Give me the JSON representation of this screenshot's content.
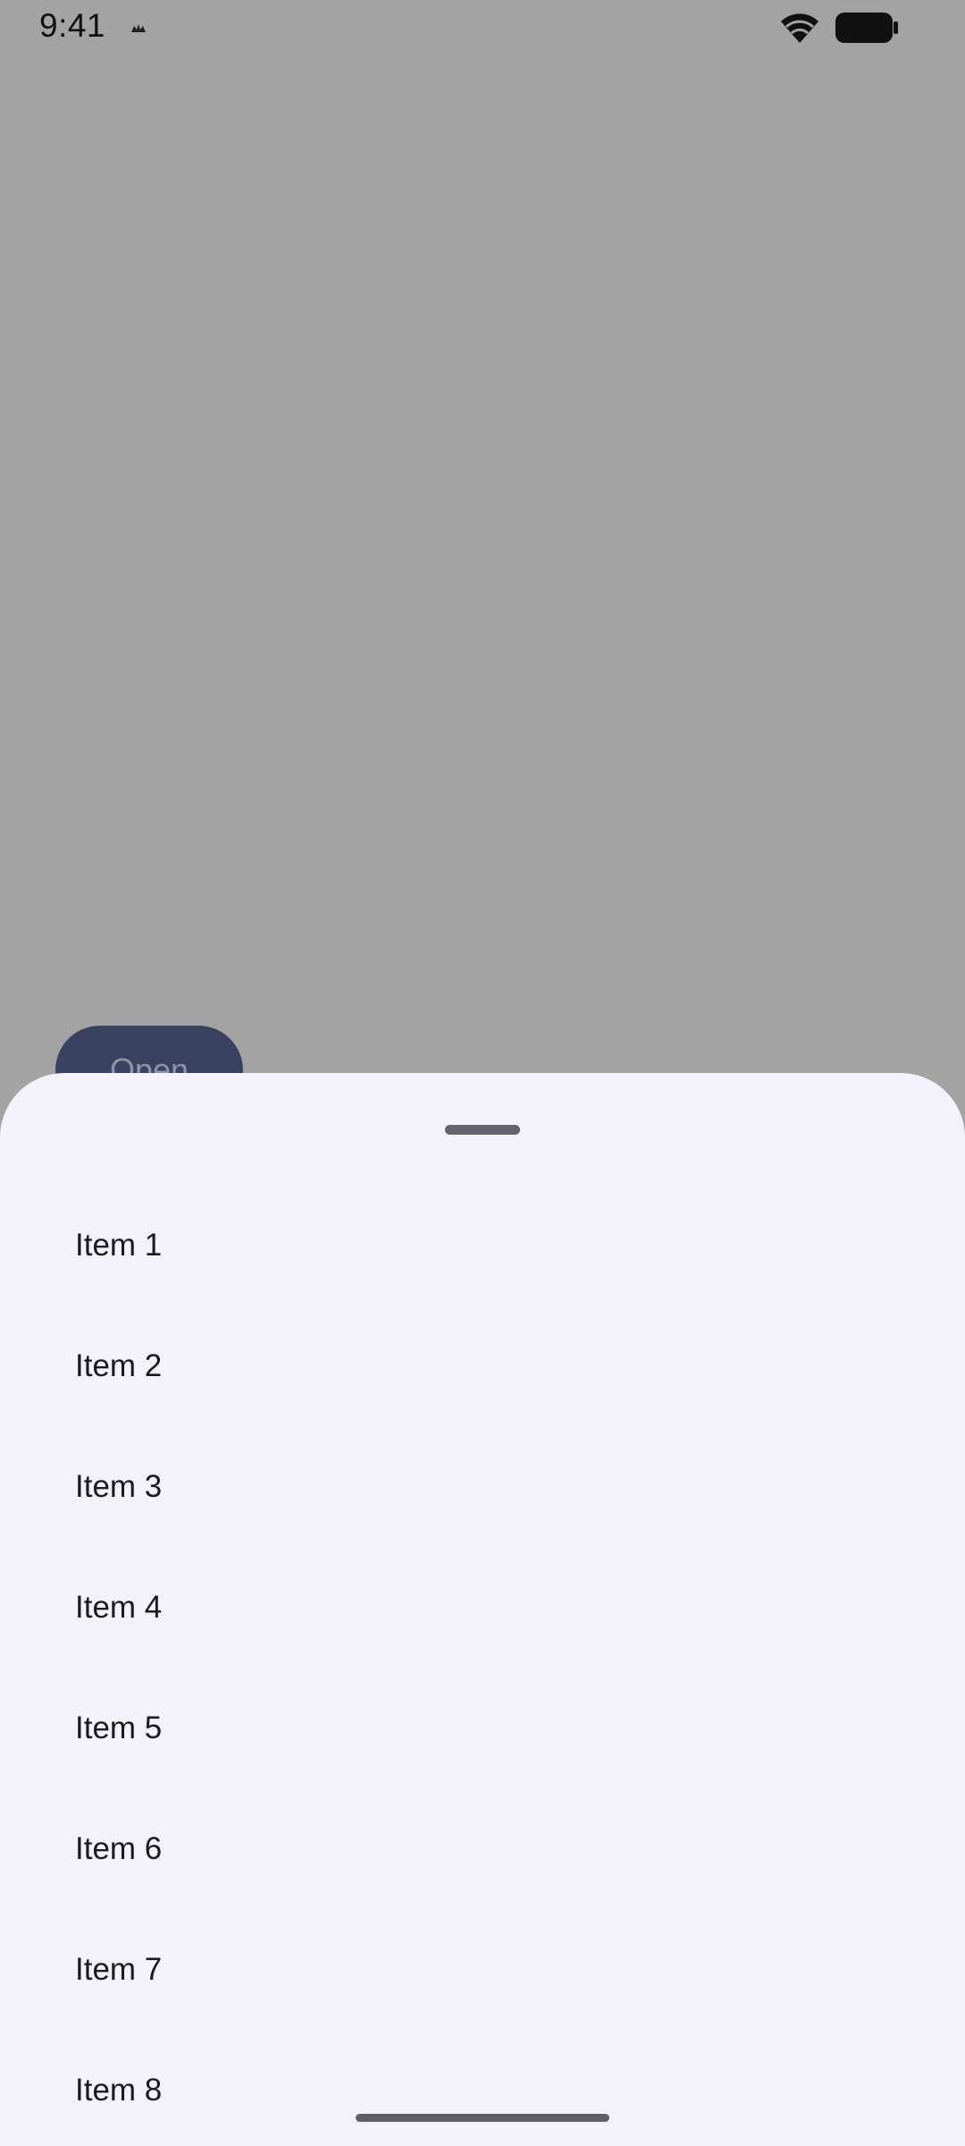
{
  "status_bar": {
    "time": "9:41",
    "icons": [
      "notification-icon",
      "wifi-icon",
      "battery-icon"
    ]
  },
  "background": {
    "open_button_label": "Open"
  },
  "bottom_sheet": {
    "items": [
      {
        "label": "Item 1"
      },
      {
        "label": "Item 2"
      },
      {
        "label": "Item 3"
      },
      {
        "label": "Item 4"
      },
      {
        "label": "Item 5"
      },
      {
        "label": "Item 6"
      },
      {
        "label": "Item 7"
      },
      {
        "label": "Item 8"
      }
    ]
  },
  "colors": {
    "scrim": "#a3a3a3",
    "sheet_background": "#f3f2fa",
    "button_background": "#3a4261",
    "text": "#1b1b1f"
  }
}
